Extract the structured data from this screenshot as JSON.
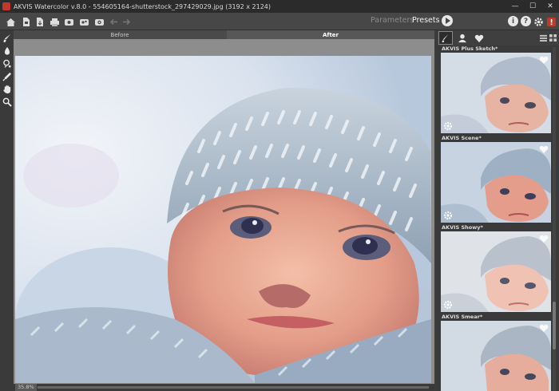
{
  "window": {
    "title": "AKVIS Watercolor v.8.0 - 554605164-shutterstock_297429029.jpg (3192 x 2124)",
    "minimize": "—",
    "maximize": "☐",
    "close": "✕"
  },
  "toolbar": {
    "icons": [
      "home-icon",
      "open-file-icon",
      "save-file-icon",
      "print-icon",
      "batch-icon",
      "share-icon",
      "settings-export-icon",
      "undo-icon",
      "redo-icon"
    ],
    "mode_parameters": "Parameters",
    "mode_presets": "Presets",
    "info_label": "i",
    "help_label": "?"
  },
  "view_tabs": {
    "before": "Before",
    "after": "After"
  },
  "status": {
    "zoom": "35.8%"
  },
  "presets_panel": {
    "items": [
      {
        "name": ""
      },
      {
        "name": "AKVIS Plus Sketch*"
      },
      {
        "name": "AKVIS Scene*"
      },
      {
        "name": "AKVIS Showy*"
      },
      {
        "name": "AKVIS Smear*"
      }
    ]
  },
  "colors": {
    "accent": "#c0392b",
    "panel_bg": "#3a3a3a",
    "toolbar_bg": "#474747",
    "canvas_bg": "#8d8d8d"
  }
}
